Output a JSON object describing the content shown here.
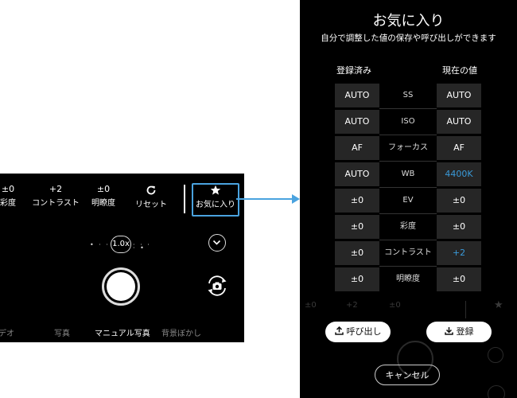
{
  "left_panel": {
    "tools": [
      {
        "value": "±0",
        "label": "彩度"
      },
      {
        "value": "+2",
        "label": "コントラスト"
      },
      {
        "value": "±0",
        "label": "明瞭度"
      },
      {
        "value": "",
        "label": "リセット",
        "icon": "refresh-icon"
      },
      {
        "value": "",
        "label": "お気に入り",
        "icon": "star-icon"
      }
    ],
    "zoom": "1.0x",
    "modes": [
      "デオ",
      "写真",
      "マニュアル写真",
      "背景ぼかし"
    ],
    "active_mode": "マニュアル写真",
    "accent_color": "#4aa3df"
  },
  "favorites": {
    "title": "お気に入り",
    "subtitle": "自分で調整した値の保存や呼び出しができます",
    "col_saved": "登録済み",
    "col_current": "現在の値",
    "rows": [
      {
        "saved": "AUTO",
        "param": "SS",
        "current": "AUTO",
        "highlight": false
      },
      {
        "saved": "AUTO",
        "param": "ISO",
        "current": "AUTO",
        "highlight": false
      },
      {
        "saved": "AF",
        "param": "フォーカス",
        "current": "AF",
        "highlight": false
      },
      {
        "saved": "AUTO",
        "param": "WB",
        "current": "4400K",
        "highlight": true
      },
      {
        "saved": "±0",
        "param": "EV",
        "current": "±0",
        "highlight": false
      },
      {
        "saved": "±0",
        "param": "彩度",
        "current": "±0",
        "highlight": false
      },
      {
        "saved": "±0",
        "param": "コントラスト",
        "current": "+2",
        "highlight": true
      },
      {
        "saved": "±0",
        "param": "明瞭度",
        "current": "±0",
        "highlight": false
      }
    ],
    "recall_button": "呼び出し",
    "register_button": "登録",
    "cancel_button": "キャンセル",
    "highlight_color": "#3a9ad9"
  }
}
